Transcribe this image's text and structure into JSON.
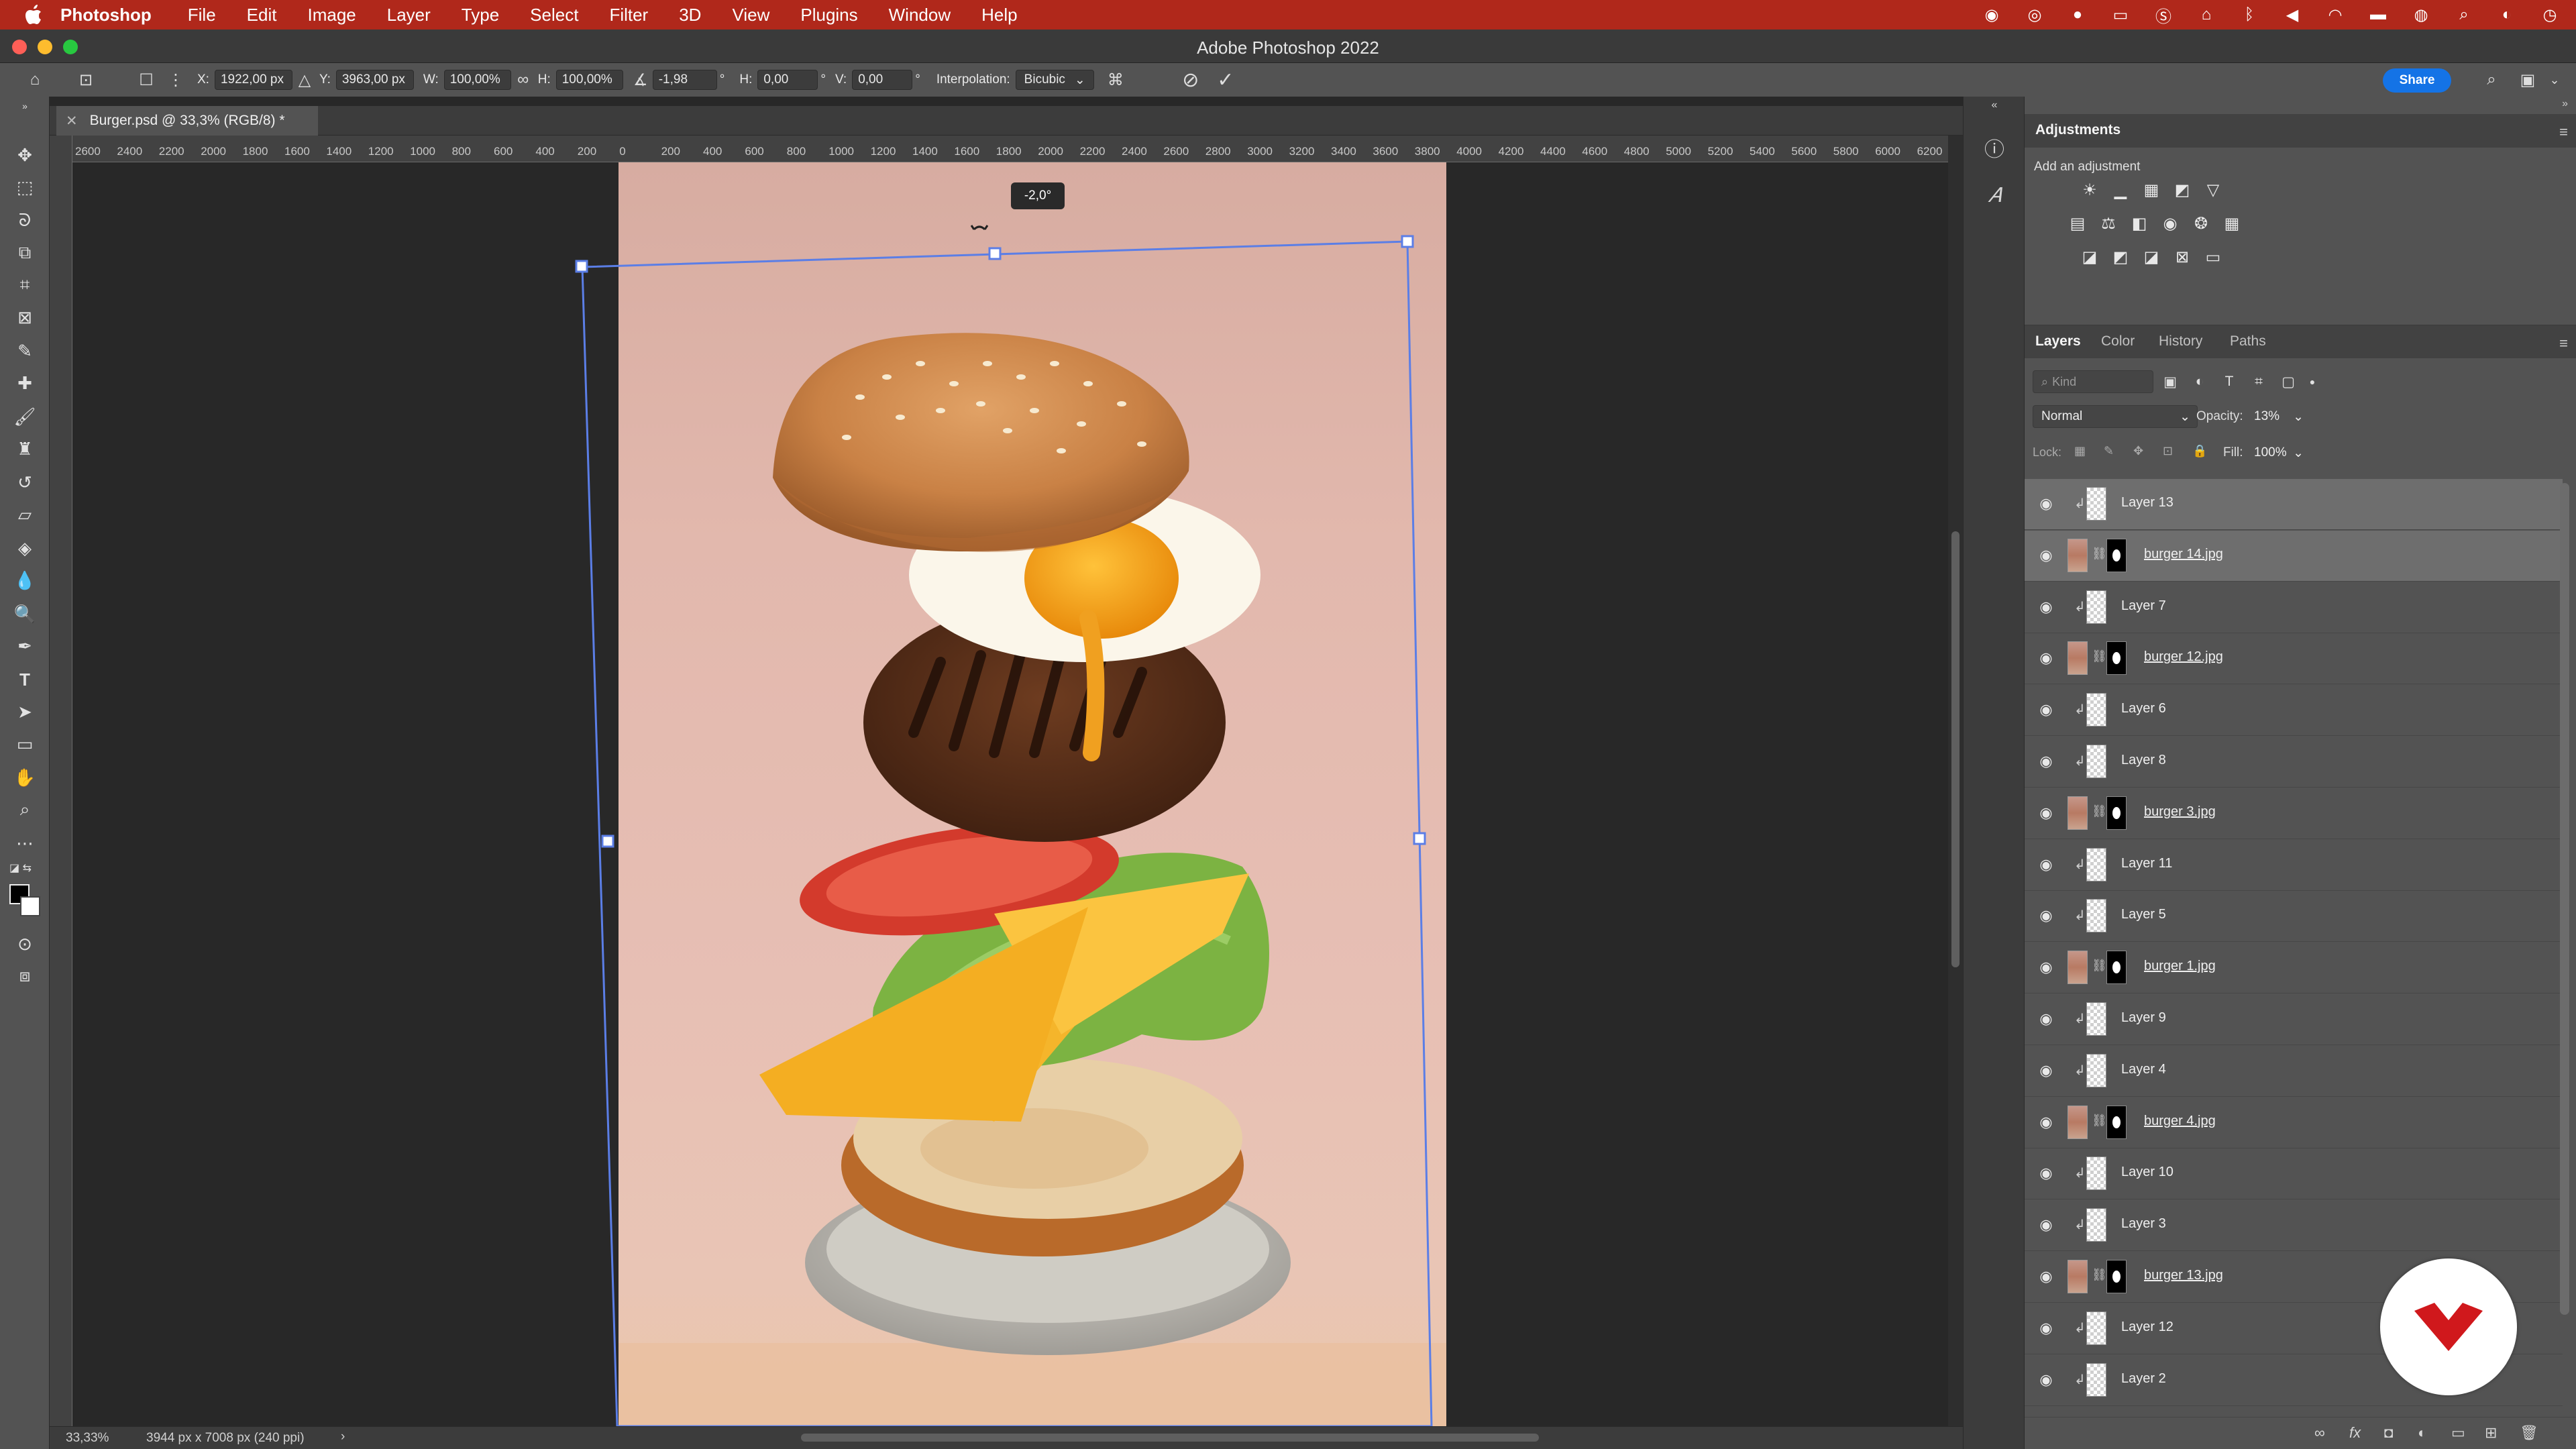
{
  "menubar": {
    "app": "Photoshop",
    "items": [
      "File",
      "Edit",
      "Image",
      "Layer",
      "Type",
      "Select",
      "Filter",
      "3D",
      "View",
      "Plugins",
      "Window",
      "Help"
    ]
  },
  "window": {
    "title": "Adobe Photoshop 2022"
  },
  "options": {
    "x_label": "X:",
    "x": "1922,00 px",
    "y_label": "Y:",
    "y": "3963,00 px",
    "w_label": "W:",
    "w": "100,00%",
    "h_label": "H:",
    "h": "100,00%",
    "angle": "-1,98",
    "hskew_label": "H:",
    "hskew": "0,00",
    "vskew_label": "V:",
    "vskew": "0,00",
    "interp_label": "Interpolation:",
    "interp": "Bicubic",
    "share": "Share"
  },
  "document": {
    "tab": "Burger.psd @ 33,3% (RGB/8) *",
    "angle_tooltip": "-2,0°",
    "ruler_h": [
      "2600",
      "2400",
      "2200",
      "2000",
      "1800",
      "1600",
      "1400",
      "1200",
      "1000",
      "800",
      "600",
      "400",
      "200",
      "0",
      "200",
      "400",
      "600",
      "800",
      "1000",
      "1200",
      "1400",
      "1600",
      "1800",
      "2000",
      "2200",
      "2400",
      "2600",
      "2800",
      "3000",
      "3200",
      "3400",
      "3600",
      "3800",
      "4000",
      "4200",
      "4400",
      "4600",
      "4800",
      "5000",
      "5200",
      "5400",
      "5600",
      "5800",
      "6000",
      "6200"
    ]
  },
  "status": {
    "zoom": "33,33%",
    "dims": "3944 px x 7008 px (240 ppi)",
    "arrow": "›"
  },
  "adjustments": {
    "title": "Adjustments",
    "subtitle": "Add an adjustment"
  },
  "layers_panel": {
    "tabs": [
      "Layers",
      "Color",
      "History",
      "Paths"
    ],
    "kind_placeholder": "Kind",
    "blend_mode": "Normal",
    "opacity_label": "Opacity:",
    "opacity": "13%",
    "lock_label": "Lock:",
    "fill_label": "Fill:",
    "fill": "100%",
    "layers": [
      {
        "name": "Layer 13",
        "type": "layer",
        "selected": true
      },
      {
        "name": "burger 14.jpg",
        "type": "photo",
        "selected": true
      },
      {
        "name": "Layer 7",
        "type": "layer",
        "selected": false
      },
      {
        "name": "burger 12.jpg",
        "type": "photo",
        "selected": false
      },
      {
        "name": "Layer 6",
        "type": "layer",
        "selected": false
      },
      {
        "name": "Layer 8",
        "type": "layer",
        "selected": false
      },
      {
        "name": "burger 3.jpg",
        "type": "photo",
        "selected": false
      },
      {
        "name": "Layer 11",
        "type": "layer",
        "selected": false
      },
      {
        "name": "Layer 5",
        "type": "layer",
        "selected": false
      },
      {
        "name": "burger 1.jpg",
        "type": "photo",
        "selected": false
      },
      {
        "name": "Layer 9",
        "type": "layer",
        "selected": false
      },
      {
        "name": "Layer 4",
        "type": "layer",
        "selected": false
      },
      {
        "name": "burger 4.jpg",
        "type": "photo",
        "selected": false
      },
      {
        "name": "Layer 10",
        "type": "layer",
        "selected": false
      },
      {
        "name": "Layer 3",
        "type": "layer",
        "selected": false
      },
      {
        "name": "burger 13.jpg",
        "type": "photo",
        "selected": false
      },
      {
        "name": "Layer 12",
        "type": "layer",
        "selected": false
      },
      {
        "name": "Layer 2",
        "type": "layer",
        "selected": false
      }
    ]
  },
  "colors": {
    "menubar": "#b0281b",
    "share_button": "#1473e6",
    "transform_box": "#5b7ee6",
    "watermark_accent": "#d0181c"
  }
}
